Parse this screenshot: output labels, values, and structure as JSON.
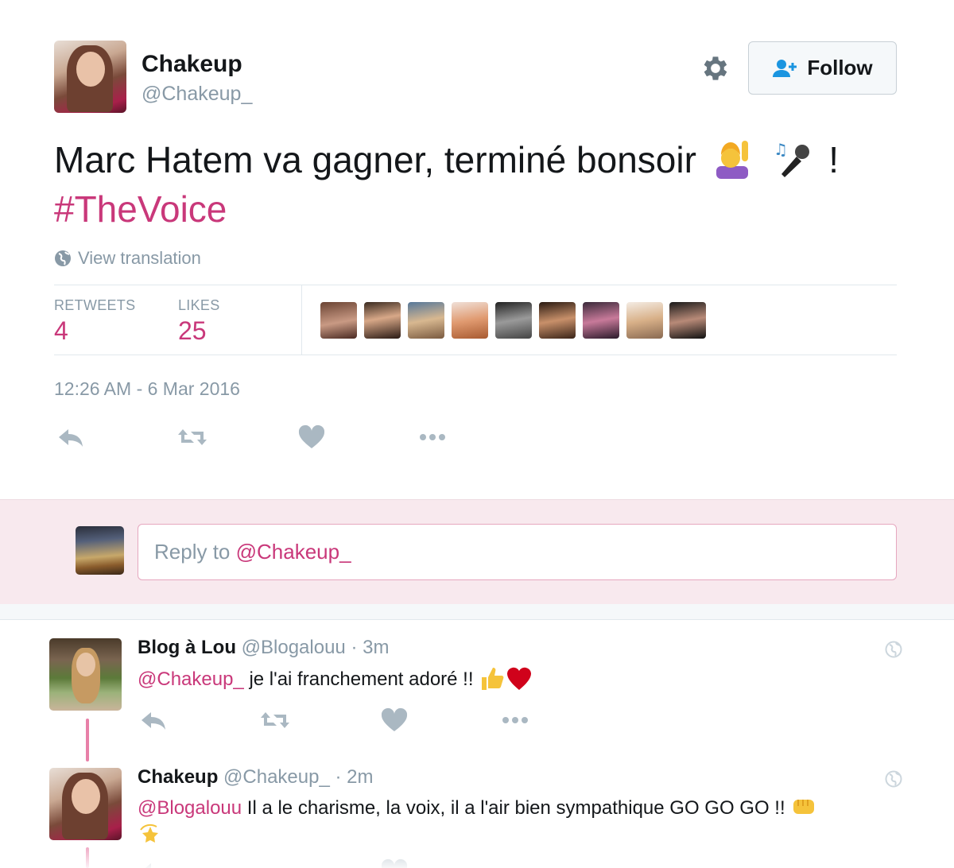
{
  "tweet": {
    "author_name": "Chakeup",
    "author_handle": "@Chakeup_",
    "text": "Marc Hatem va gagner, terminé bonsoir",
    "text_end": "!",
    "hashtag": "#TheVoice",
    "view_translation": "View translation",
    "retweets_label": "RETWEETS",
    "retweets_count": "4",
    "likes_label": "LIKES",
    "likes_count": "25",
    "timestamp": "12:26 AM - 6 Mar 2016",
    "emojis": [
      "person-raising-hand-emoji",
      "microphone-emoji"
    ]
  },
  "header": {
    "follow_label": "Follow"
  },
  "reply_box": {
    "prefix": "Reply to ",
    "mention": "@Chakeup_"
  },
  "replies": [
    {
      "name": "Blog à Lou",
      "handle": "@Blogalouu",
      "time": "· 3m",
      "mention": "@Chakeup_",
      "text": " je l'ai franchement adoré !!",
      "emojis": [
        "thumbs-up-emoji",
        "red-heart-emoji"
      ]
    },
    {
      "name": "Chakeup",
      "handle": "@Chakeup_",
      "time": "· 2m",
      "mention": "@Blogalouu",
      "text": " Il a le charisme, la voix, il a l'air bien sympathique GO GO GO !!",
      "emojis": [
        "fist-emoji",
        "dizzy-star-emoji"
      ]
    }
  ],
  "colors": {
    "accent": "#c9387a",
    "muted": "#8899a6",
    "reply_band": "#f8e9ee"
  }
}
